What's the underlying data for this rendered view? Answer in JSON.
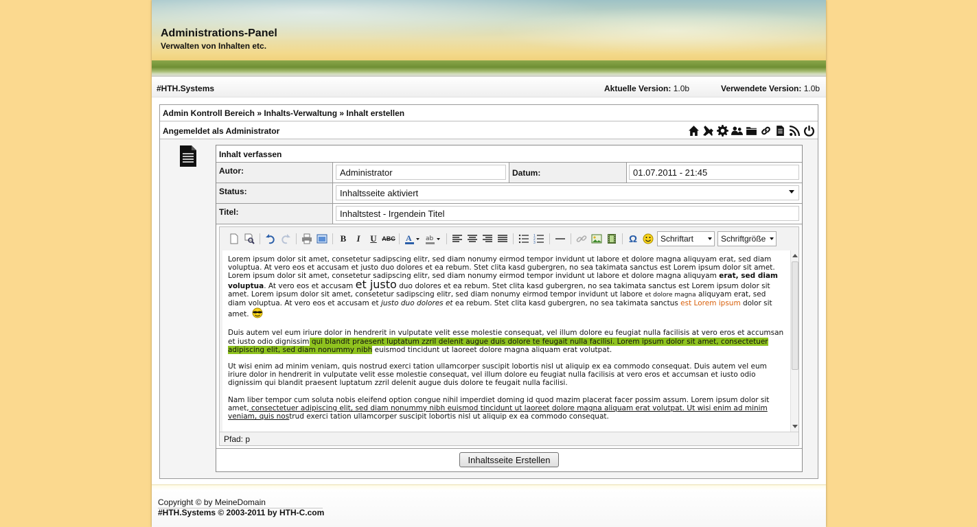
{
  "header": {
    "title": "Administrations-Panel",
    "subtitle": "Verwalten von Inhalten etc."
  },
  "versionbar": {
    "brand": "#HTH.Systems",
    "current_label": "Aktuelle Version:",
    "current_value": "1.0b",
    "used_label": "Verwendete Version:",
    "used_value": "1.0b"
  },
  "breadcrumb": "Admin Kontroll Bereich » Inhalts-Verwaltung » Inhalt erstellen",
  "login": {
    "text": "Angemeldet als Administrator",
    "icons": [
      "home-icon",
      "tools-icon",
      "gear-icon",
      "users-icon",
      "folder-icon",
      "link-icon",
      "document-icon",
      "rss-icon",
      "power-icon"
    ]
  },
  "form": {
    "section_title": "Inhalt verfassen",
    "autor_label": "Autor:",
    "autor_value": "Administrator",
    "datum_label": "Datum:",
    "datum_value": "01.07.2011 - 21:45",
    "status_label": "Status:",
    "status_value": "Inhaltsseite aktiviert",
    "titel_label": "Titel:",
    "titel_value": "Inhaltstest - Irgendein Titel",
    "submit_label": "Inhaltsseite Erstellen"
  },
  "editor": {
    "font_select": "Schriftart",
    "size_select": "Schriftgröße",
    "path": "Pfad: p",
    "toolbar_icons": [
      "new-document-icon",
      "preview-icon",
      "undo-icon",
      "redo-icon",
      "print-icon",
      "fullscreen-icon",
      "bold-icon",
      "italic-icon",
      "underline-icon",
      "strikethrough-icon",
      "text-color-icon",
      "highlight-color-icon",
      "align-left-icon",
      "align-center-icon",
      "align-right-icon",
      "align-justify-icon",
      "bullet-list-icon",
      "numbered-list-icon",
      "horizontal-rule-icon",
      "link-icon",
      "image-icon",
      "media-icon",
      "special-char-icon",
      "emoticon-icon"
    ],
    "p1": {
      "a": "Lorem ipsum dolor sit amet, consetetur sadipscing elitr, sed diam nonumy eirmod tempor invidunt ut labore et dolore magna aliquyam erat, sed diam voluptua. At vero eos et accusam et justo duo dolores et ea rebum. Stet clita kasd gubergren, no sea takimata sanctus est Lorem ipsum dolor sit amet. Lorem ipsum dolor sit amet, consetetur sadipscing elitr, sed diam nonumy eirmod tempor invidunt ut labore et dolore magna aliquyam",
      "bold": "erat, sed diam voluptua",
      "b": ". At vero eos et accusam",
      "big": "et justo",
      "c": "duo dolores et ea rebum. Stet clita kasd gubergren, no sea takimata sanctus est Lorem ipsum dolor sit amet. Lorem ipsum dolor sit amet, consetetur sadipscing elitr, sed diam nonumy eirmod tempor invidunt ut labore",
      "small": "et dolore magna",
      "d": "aliquyam erat, sed diam voluptua. At vero eos et accusam et",
      "italic": "justo duo dolores et",
      "e": "ea rebum. Stet clita kasd gubergren, no sea takimata sanctus",
      "orange": "est Lorem ipsum",
      "f": "dolor sit amet."
    },
    "p2": {
      "a": "Duis autem vel eum iriure dolor in hendrerit in vulputate velit esse molestie consequat, vel illum dolore eu feugiat nulla facilisis at vero eros et accumsan et iusto odio dignissim",
      "highlight": " qui blandit praesent luptatum zzril delenit augue duis dolore te feugait nulla facilisi. Lorem ipsum dolor sit amet, consectetuer adipiscing elit, sed diam nonummy nibh",
      "b": " euismod tincidunt ut laoreet dolore magna aliquam erat volutpat."
    },
    "p3": "Ut wisi enim ad minim veniam, quis nostrud exerci tation ullamcorper suscipit lobortis nisl ut aliquip ex ea commodo consequat. Duis autem vel eum iriure dolor in hendrerit in vulputate velit esse molestie consequat, vel illum dolore eu feugiat nulla facilisis at vero eros et accumsan et iusto odio dignissim qui blandit praesent luptatum zzril delenit augue duis dolore te feugait nulla facilisi.",
    "p4": {
      "a": "Nam liber tempor cum soluta nobis eleifend option congue nihil imperdiet doming id quod mazim placerat facer possim assum. Lorem ipsum dolor sit amet,",
      "underlined": " consectetuer adipiscing elit, sed diam nonummy nibh euismod tincidunt ut laoreet dolore magna aliquam erat volutpat. Ut wisi enim ad minim veniam, quis nos",
      "b": "trud exerci tation ullamcorper suscipit lobortis nisl ut aliquip ex ea commodo consequat."
    }
  },
  "footer": {
    "copyright": "Copyright © by MeineDomain",
    "credit": "#HTH.Systems © 2003-2011 by HTH-C.com"
  },
  "colors": {
    "background": "#fbd98f",
    "highlight": "#8fc31f",
    "orange_text": "#d85f0a"
  }
}
